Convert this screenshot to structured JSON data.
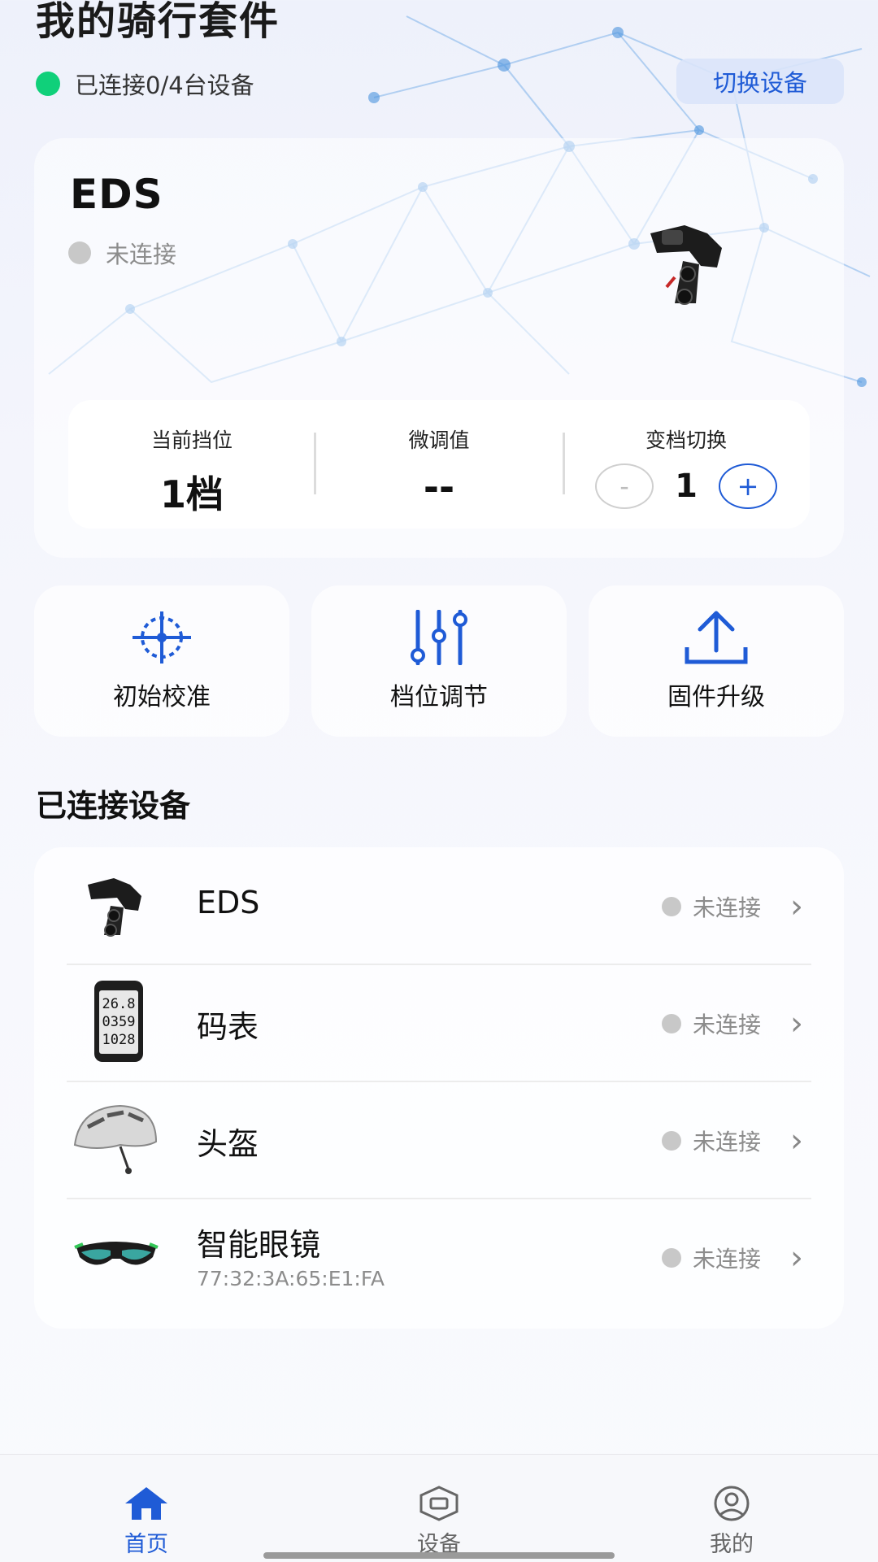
{
  "header": {
    "title": "我的骑行套件",
    "connection_summary": "已连接0/4台设备",
    "switch_device_label": "切换设备"
  },
  "device_card": {
    "name": "EDS",
    "status": "未连接",
    "current_gear_label": "当前挡位",
    "current_gear_value": "1档",
    "fine_tune_label": "微调值",
    "fine_tune_value": "--",
    "shift_label": "变档切换",
    "shift_value": "1",
    "minus_label": "-",
    "plus_label": "+"
  },
  "quick_actions": [
    {
      "label": "初始校准",
      "icon": "crosshair-icon"
    },
    {
      "label": "档位调节",
      "icon": "sliders-icon"
    },
    {
      "label": "固件升级",
      "icon": "upload-icon"
    }
  ],
  "connected_section": {
    "title": "已连接设备",
    "devices": [
      {
        "name": "EDS",
        "status": "未连接",
        "address": ""
      },
      {
        "name": "码表",
        "status": "未连接",
        "address": ""
      },
      {
        "name": "头盔",
        "status": "未连接",
        "address": ""
      },
      {
        "name": "智能眼镜",
        "status": "未连接",
        "address": "77:32:3A:65:E1:FA"
      }
    ]
  },
  "bike_computer_display": {
    "line1": "26.8",
    "line2": "0359",
    "line3": "1028"
  },
  "tabbar": {
    "tabs": [
      {
        "label": "首页",
        "icon": "home-icon",
        "active": true
      },
      {
        "label": "设备",
        "icon": "device-icon",
        "active": false
      },
      {
        "label": "我的",
        "icon": "profile-icon",
        "active": false
      }
    ]
  },
  "colors": {
    "accent": "#1f5bd6",
    "connected": "#10d07a",
    "disconnected": "#c8c8c8"
  }
}
